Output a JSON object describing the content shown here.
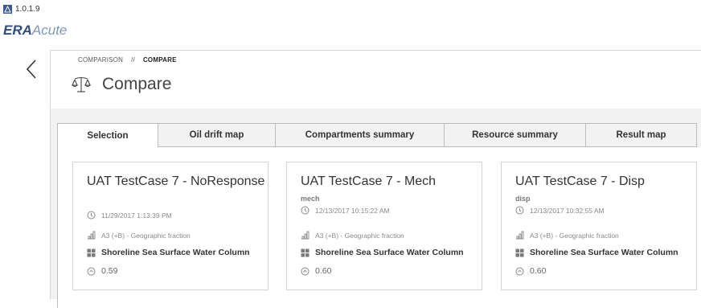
{
  "app": {
    "version": "1.0.1.9",
    "name_bold": "ERA",
    "name_light": "Acute"
  },
  "breadcrumb": {
    "parent": "COMPARISON",
    "separator": "//",
    "current": "COMPARE"
  },
  "page": {
    "title": "Compare",
    "icon": "scales-icon"
  },
  "tabs": [
    {
      "label": "Selection",
      "active": true
    },
    {
      "label": "Oil drift map",
      "active": false
    },
    {
      "label": "Compartments summary",
      "active": false
    },
    {
      "label": "Resource summary",
      "active": false
    },
    {
      "label": "Result map",
      "active": false
    }
  ],
  "cards": [
    {
      "title": "UAT TestCase 7 - NoResponse",
      "subtitle": "",
      "timestamp": "11/29/2017 1:13:39 PM",
      "method": "A3 (+B) - Geographic fraction",
      "compartments": "Shoreline Sea Surface Water Column",
      "value": "0.59"
    },
    {
      "title": "UAT TestCase 7 - Mech",
      "subtitle": "mech",
      "timestamp": "12/13/2017 10:15:22 AM",
      "method": "A3 (+B) - Geographic fraction",
      "compartments": "Shoreline Sea Surface Water Column",
      "value": "0.60"
    },
    {
      "title": "UAT TestCase 7 - Disp",
      "subtitle": "disp",
      "timestamp": "12/13/2017 10:32:55 AM",
      "method": "A3 (+B) - Geographic fraction",
      "compartments": "Shoreline Sea Surface Water Column",
      "value": "0.60"
    }
  ],
  "colors": {
    "brand": "#2f4d80",
    "brand_light": "#7f97bf",
    "panel_bg": "#f2f2f2",
    "border": "#bdbdbd"
  }
}
